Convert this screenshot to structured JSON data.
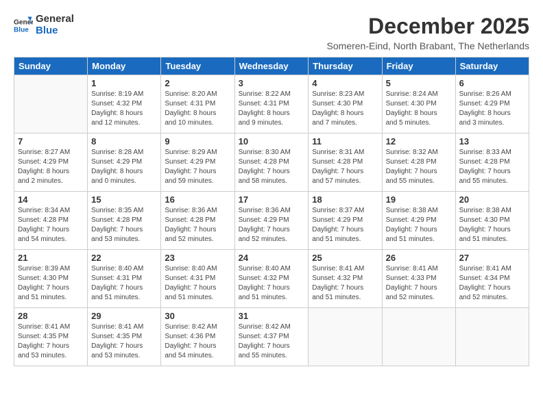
{
  "header": {
    "logo_line1": "General",
    "logo_line2": "Blue",
    "month_title": "December 2025",
    "location": "Someren-Eind, North Brabant, The Netherlands"
  },
  "days_of_week": [
    "Sunday",
    "Monday",
    "Tuesday",
    "Wednesday",
    "Thursday",
    "Friday",
    "Saturday"
  ],
  "weeks": [
    [
      {
        "day": "",
        "info": ""
      },
      {
        "day": "1",
        "info": "Sunrise: 8:19 AM\nSunset: 4:32 PM\nDaylight: 8 hours\nand 12 minutes."
      },
      {
        "day": "2",
        "info": "Sunrise: 8:20 AM\nSunset: 4:31 PM\nDaylight: 8 hours\nand 10 minutes."
      },
      {
        "day": "3",
        "info": "Sunrise: 8:22 AM\nSunset: 4:31 PM\nDaylight: 8 hours\nand 9 minutes."
      },
      {
        "day": "4",
        "info": "Sunrise: 8:23 AM\nSunset: 4:30 PM\nDaylight: 8 hours\nand 7 minutes."
      },
      {
        "day": "5",
        "info": "Sunrise: 8:24 AM\nSunset: 4:30 PM\nDaylight: 8 hours\nand 5 minutes."
      },
      {
        "day": "6",
        "info": "Sunrise: 8:26 AM\nSunset: 4:29 PM\nDaylight: 8 hours\nand 3 minutes."
      }
    ],
    [
      {
        "day": "7",
        "info": "Sunrise: 8:27 AM\nSunset: 4:29 PM\nDaylight: 8 hours\nand 2 minutes."
      },
      {
        "day": "8",
        "info": "Sunrise: 8:28 AM\nSunset: 4:29 PM\nDaylight: 8 hours\nand 0 minutes."
      },
      {
        "day": "9",
        "info": "Sunrise: 8:29 AM\nSunset: 4:29 PM\nDaylight: 7 hours\nand 59 minutes."
      },
      {
        "day": "10",
        "info": "Sunrise: 8:30 AM\nSunset: 4:28 PM\nDaylight: 7 hours\nand 58 minutes."
      },
      {
        "day": "11",
        "info": "Sunrise: 8:31 AM\nSunset: 4:28 PM\nDaylight: 7 hours\nand 57 minutes."
      },
      {
        "day": "12",
        "info": "Sunrise: 8:32 AM\nSunset: 4:28 PM\nDaylight: 7 hours\nand 55 minutes."
      },
      {
        "day": "13",
        "info": "Sunrise: 8:33 AM\nSunset: 4:28 PM\nDaylight: 7 hours\nand 55 minutes."
      }
    ],
    [
      {
        "day": "14",
        "info": "Sunrise: 8:34 AM\nSunset: 4:28 PM\nDaylight: 7 hours\nand 54 minutes."
      },
      {
        "day": "15",
        "info": "Sunrise: 8:35 AM\nSunset: 4:28 PM\nDaylight: 7 hours\nand 53 minutes."
      },
      {
        "day": "16",
        "info": "Sunrise: 8:36 AM\nSunset: 4:28 PM\nDaylight: 7 hours\nand 52 minutes."
      },
      {
        "day": "17",
        "info": "Sunrise: 8:36 AM\nSunset: 4:29 PM\nDaylight: 7 hours\nand 52 minutes."
      },
      {
        "day": "18",
        "info": "Sunrise: 8:37 AM\nSunset: 4:29 PM\nDaylight: 7 hours\nand 51 minutes."
      },
      {
        "day": "19",
        "info": "Sunrise: 8:38 AM\nSunset: 4:29 PM\nDaylight: 7 hours\nand 51 minutes."
      },
      {
        "day": "20",
        "info": "Sunrise: 8:38 AM\nSunset: 4:30 PM\nDaylight: 7 hours\nand 51 minutes."
      }
    ],
    [
      {
        "day": "21",
        "info": "Sunrise: 8:39 AM\nSunset: 4:30 PM\nDaylight: 7 hours\nand 51 minutes."
      },
      {
        "day": "22",
        "info": "Sunrise: 8:40 AM\nSunset: 4:31 PM\nDaylight: 7 hours\nand 51 minutes."
      },
      {
        "day": "23",
        "info": "Sunrise: 8:40 AM\nSunset: 4:31 PM\nDaylight: 7 hours\nand 51 minutes."
      },
      {
        "day": "24",
        "info": "Sunrise: 8:40 AM\nSunset: 4:32 PM\nDaylight: 7 hours\nand 51 minutes."
      },
      {
        "day": "25",
        "info": "Sunrise: 8:41 AM\nSunset: 4:32 PM\nDaylight: 7 hours\nand 51 minutes."
      },
      {
        "day": "26",
        "info": "Sunrise: 8:41 AM\nSunset: 4:33 PM\nDaylight: 7 hours\nand 52 minutes."
      },
      {
        "day": "27",
        "info": "Sunrise: 8:41 AM\nSunset: 4:34 PM\nDaylight: 7 hours\nand 52 minutes."
      }
    ],
    [
      {
        "day": "28",
        "info": "Sunrise: 8:41 AM\nSunset: 4:35 PM\nDaylight: 7 hours\nand 53 minutes."
      },
      {
        "day": "29",
        "info": "Sunrise: 8:41 AM\nSunset: 4:35 PM\nDaylight: 7 hours\nand 53 minutes."
      },
      {
        "day": "30",
        "info": "Sunrise: 8:42 AM\nSunset: 4:36 PM\nDaylight: 7 hours\nand 54 minutes."
      },
      {
        "day": "31",
        "info": "Sunrise: 8:42 AM\nSunset: 4:37 PM\nDaylight: 7 hours\nand 55 minutes."
      },
      {
        "day": "",
        "info": ""
      },
      {
        "day": "",
        "info": ""
      },
      {
        "day": "",
        "info": ""
      }
    ]
  ]
}
